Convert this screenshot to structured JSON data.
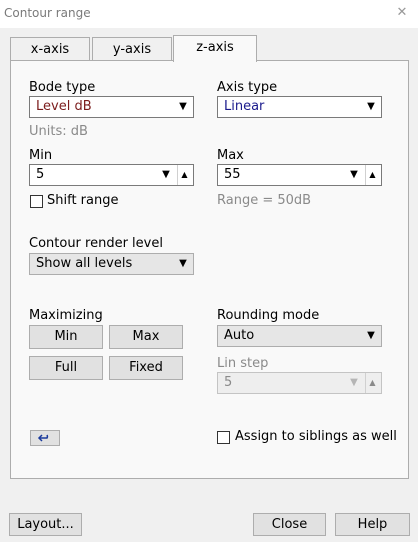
{
  "window": {
    "title": "Contour range",
    "close_glyph": "✕"
  },
  "tabs": [
    {
      "label": "x-axis",
      "active": false
    },
    {
      "label": "y-axis",
      "active": false
    },
    {
      "label": "z-axis",
      "active": true
    }
  ],
  "bode_type": {
    "label": "Bode type",
    "value": "Level dB",
    "value_color": "#7b1c1c"
  },
  "units": {
    "text": "Units: dB"
  },
  "axis_type": {
    "label": "Axis type",
    "value": "Linear",
    "value_color": "#1a1a8c"
  },
  "min": {
    "label": "Min",
    "value": "5"
  },
  "max": {
    "label": "Max",
    "value": "55"
  },
  "range_info": {
    "text": "Range = 50dB"
  },
  "shift_range": {
    "label": "Shift range",
    "checked": false
  },
  "contour_render": {
    "label": "Contour render level",
    "value": "Show all levels"
  },
  "maximizing": {
    "label": "Maximizing",
    "buttons": {
      "min": "Min",
      "max": "Max",
      "full": "Full",
      "fixed": "Fixed"
    }
  },
  "rounding_mode": {
    "label": "Rounding mode",
    "value": "Auto"
  },
  "lin_step": {
    "label": "Lin step",
    "value": "5"
  },
  "assign_siblings": {
    "label": "Assign to siblings as well",
    "checked": false
  },
  "reset_icon": "undo-arrow-icon",
  "footer": {
    "layout": "Layout...",
    "close": "Close",
    "help": "Help"
  }
}
